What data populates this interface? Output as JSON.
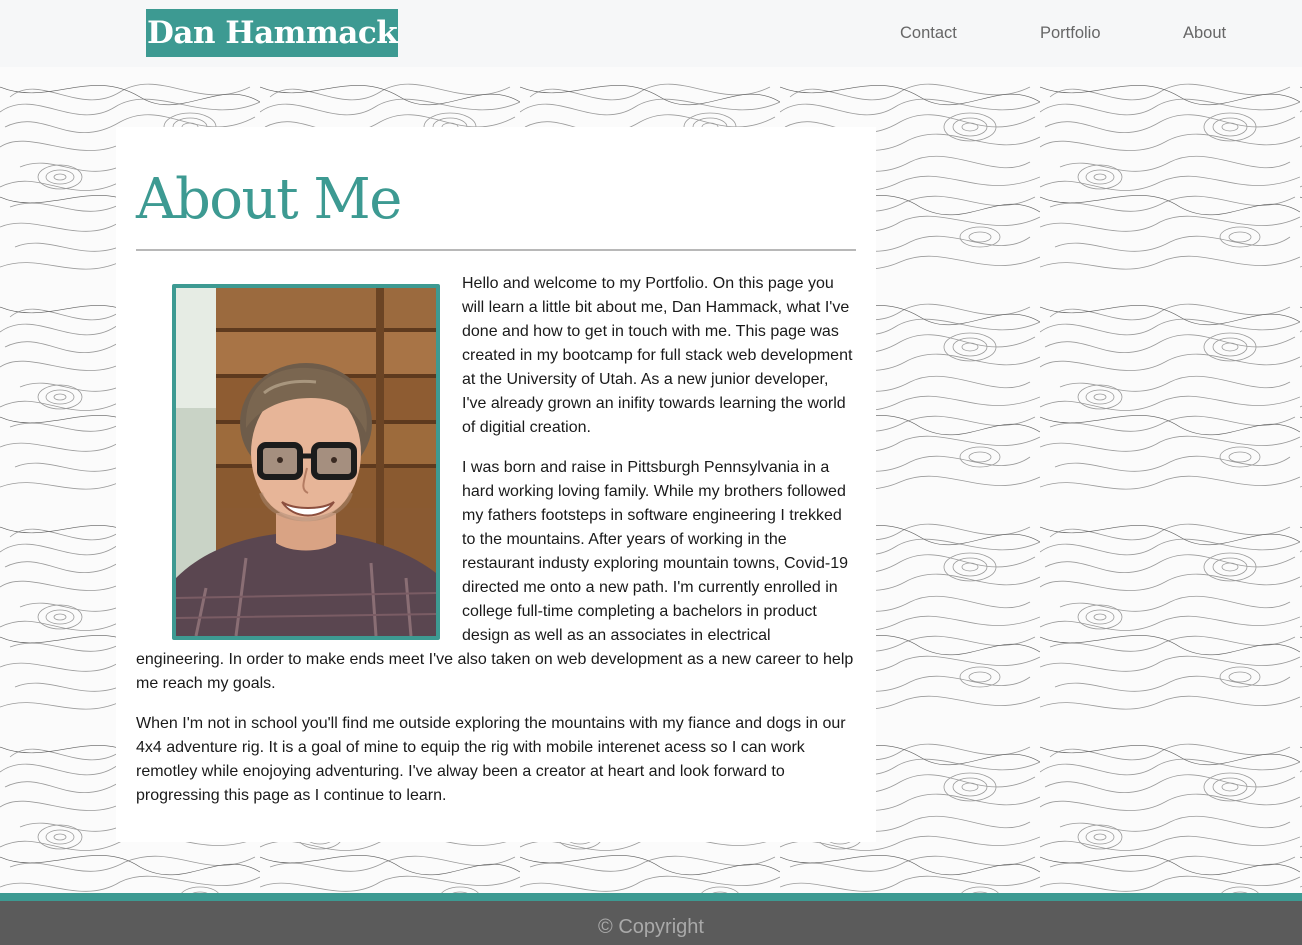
{
  "header": {
    "brand": "Dan Hammack",
    "nav": [
      {
        "label": "Contact"
      },
      {
        "label": "Portfolio"
      },
      {
        "label": "About"
      }
    ]
  },
  "about": {
    "title": "About Me",
    "photo_icon": "profile-photo",
    "paragraphs": [
      "Hello and welcome to my Portfolio. On this page you will learn a little bit about me, Dan Hammack, what I've done and how to get in touch with me. This page was created in my bootcamp for full stack web development at the University of Utah. As a new junior developer, I've already grown an inifity towards learning the world of digitial creation.",
      "I was born and raise in Pittsburgh Pennsylvania in a hard working loving family. While my brothers followed my fathers footsteps in software engineering I trekked to the mountains. After years of working in the restaurant industy exploring mountain towns, Covid-19 directed me onto a new path. I'm currently enrolled in college full-time completing a bachelors in product design as well as an associates in electrical engineering. In order to make ends meet I've also taken on web development as a new career to help me reach my goals.",
      "When I'm not in school you'll find me outside exploring the mountains with my fiance and dogs in our 4x4 adventure rig. It is a goal of mine to equip the rig with mobile interenet acess so I can work remotley while enojoying adventuring. I've alway been a creator at heart and look forward to progressing this page as I continue to learn."
    ]
  },
  "footer": {
    "text": "© Copyright"
  },
  "colors": {
    "accent": "#3d9a92",
    "footer_bg": "#5b5b5b",
    "nav_bg": "#f6f7f8",
    "nav_text": "#666666"
  }
}
